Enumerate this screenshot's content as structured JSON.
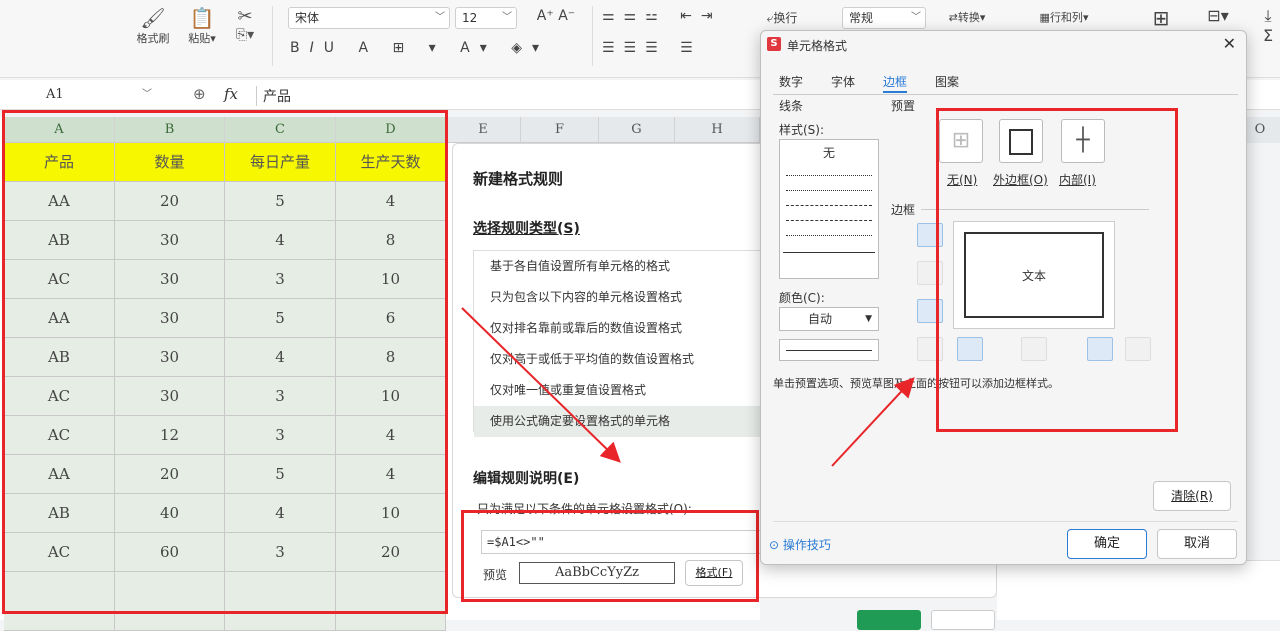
{
  "ribbon": {
    "format_painter": "格式刷",
    "paste": "粘贴",
    "font_name": "宋体",
    "font_size": "12",
    "wrap": "换行",
    "number_format": "常规",
    "convert": "转换",
    "rows_cols": "行和列"
  },
  "formula_bar": {
    "cell_ref": "A1",
    "fx": "fx",
    "value": "产品"
  },
  "sheet": {
    "columns": [
      "A",
      "B",
      "C",
      "D",
      "E",
      "F",
      "G",
      "H",
      "O"
    ],
    "header": [
      "产品",
      "数量",
      "每日产量",
      "生产天数"
    ],
    "rows": [
      [
        "AA",
        "20",
        "5",
        "4"
      ],
      [
        "AB",
        "30",
        "4",
        "8"
      ],
      [
        "AC",
        "30",
        "3",
        "10"
      ],
      [
        "AA",
        "30",
        "5",
        "6"
      ],
      [
        "AB",
        "30",
        "4",
        "8"
      ],
      [
        "AC",
        "30",
        "3",
        "10"
      ],
      [
        "AC",
        "12",
        "3",
        "4"
      ],
      [
        "AA",
        "20",
        "5",
        "4"
      ],
      [
        "AB",
        "40",
        "4",
        "10"
      ],
      [
        "AC",
        "60",
        "3",
        "20"
      ]
    ]
  },
  "rule_panel": {
    "title": "新建格式规则",
    "select_type": "选择规则类型(S)",
    "rules": [
      "基于各自值设置所有单元格的格式",
      "只为包含以下内容的单元格设置格式",
      "仅对排名靠前或靠后的数值设置格式",
      "仅对高于或低于平均值的数值设置格式",
      "仅对唯一值或重复值设置格式",
      "使用公式确定要设置格式的单元格"
    ],
    "edit_desc": "编辑规则说明(E)",
    "condition_label": "只为满足以下条件的单元格设置格式(O):",
    "formula": "=$A1<>\"\"",
    "preview_label": "预览",
    "preview_text": "AaBbCcYyZz",
    "format_button": "格式(F)"
  },
  "dialog": {
    "title": "单元格格式",
    "tabs": [
      "数字",
      "字体",
      "边框",
      "图案"
    ],
    "line_group": "线条",
    "style_label": "样式(S):",
    "none_style": "无",
    "color_label": "颜色(C):",
    "color_value": "自动",
    "preset_group": "预置",
    "preset_none": "无(N)",
    "preset_outline": "外边框(O)",
    "preset_inside": "内部(I)",
    "border_group": "边框",
    "preview_text": "文本",
    "hint": "单击预置选项、预览草图及上面的按钮可以添加边框样式。",
    "clear": "清除(R)",
    "tips": "操作技巧",
    "ok": "确定",
    "cancel": "取消"
  },
  "colors": {
    "accent": "#2a7bd6",
    "highlight": "#f7f700",
    "sheet_fill": "#e5ede4",
    "annotation": "#e8262a"
  }
}
